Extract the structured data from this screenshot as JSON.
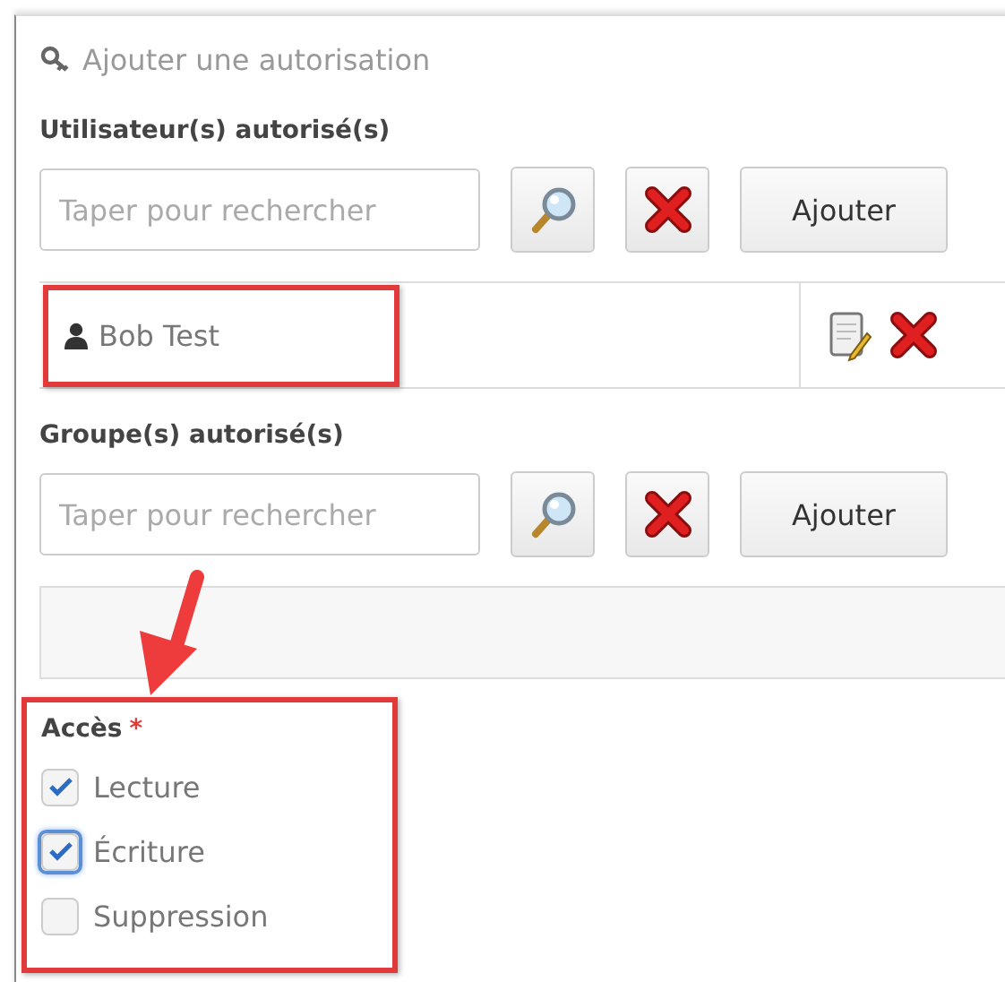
{
  "title": "Ajouter une autorisation",
  "users": {
    "label": "Utilisateur(s) autorisé(s)",
    "placeholder": "Taper pour rechercher",
    "add_button": "Ajouter",
    "entries": [
      {
        "name": "Bob Test"
      }
    ]
  },
  "groups": {
    "label": "Groupe(s) autorisé(s)",
    "placeholder": "Taper pour rechercher",
    "add_button": "Ajouter"
  },
  "access": {
    "label": "Accès",
    "required_mark": "*",
    "options": [
      {
        "label": "Lecture",
        "checked": true,
        "focused": false
      },
      {
        "label": "Écriture",
        "checked": true,
        "focused": true
      },
      {
        "label": "Suppression",
        "checked": false,
        "focused": false
      }
    ]
  }
}
